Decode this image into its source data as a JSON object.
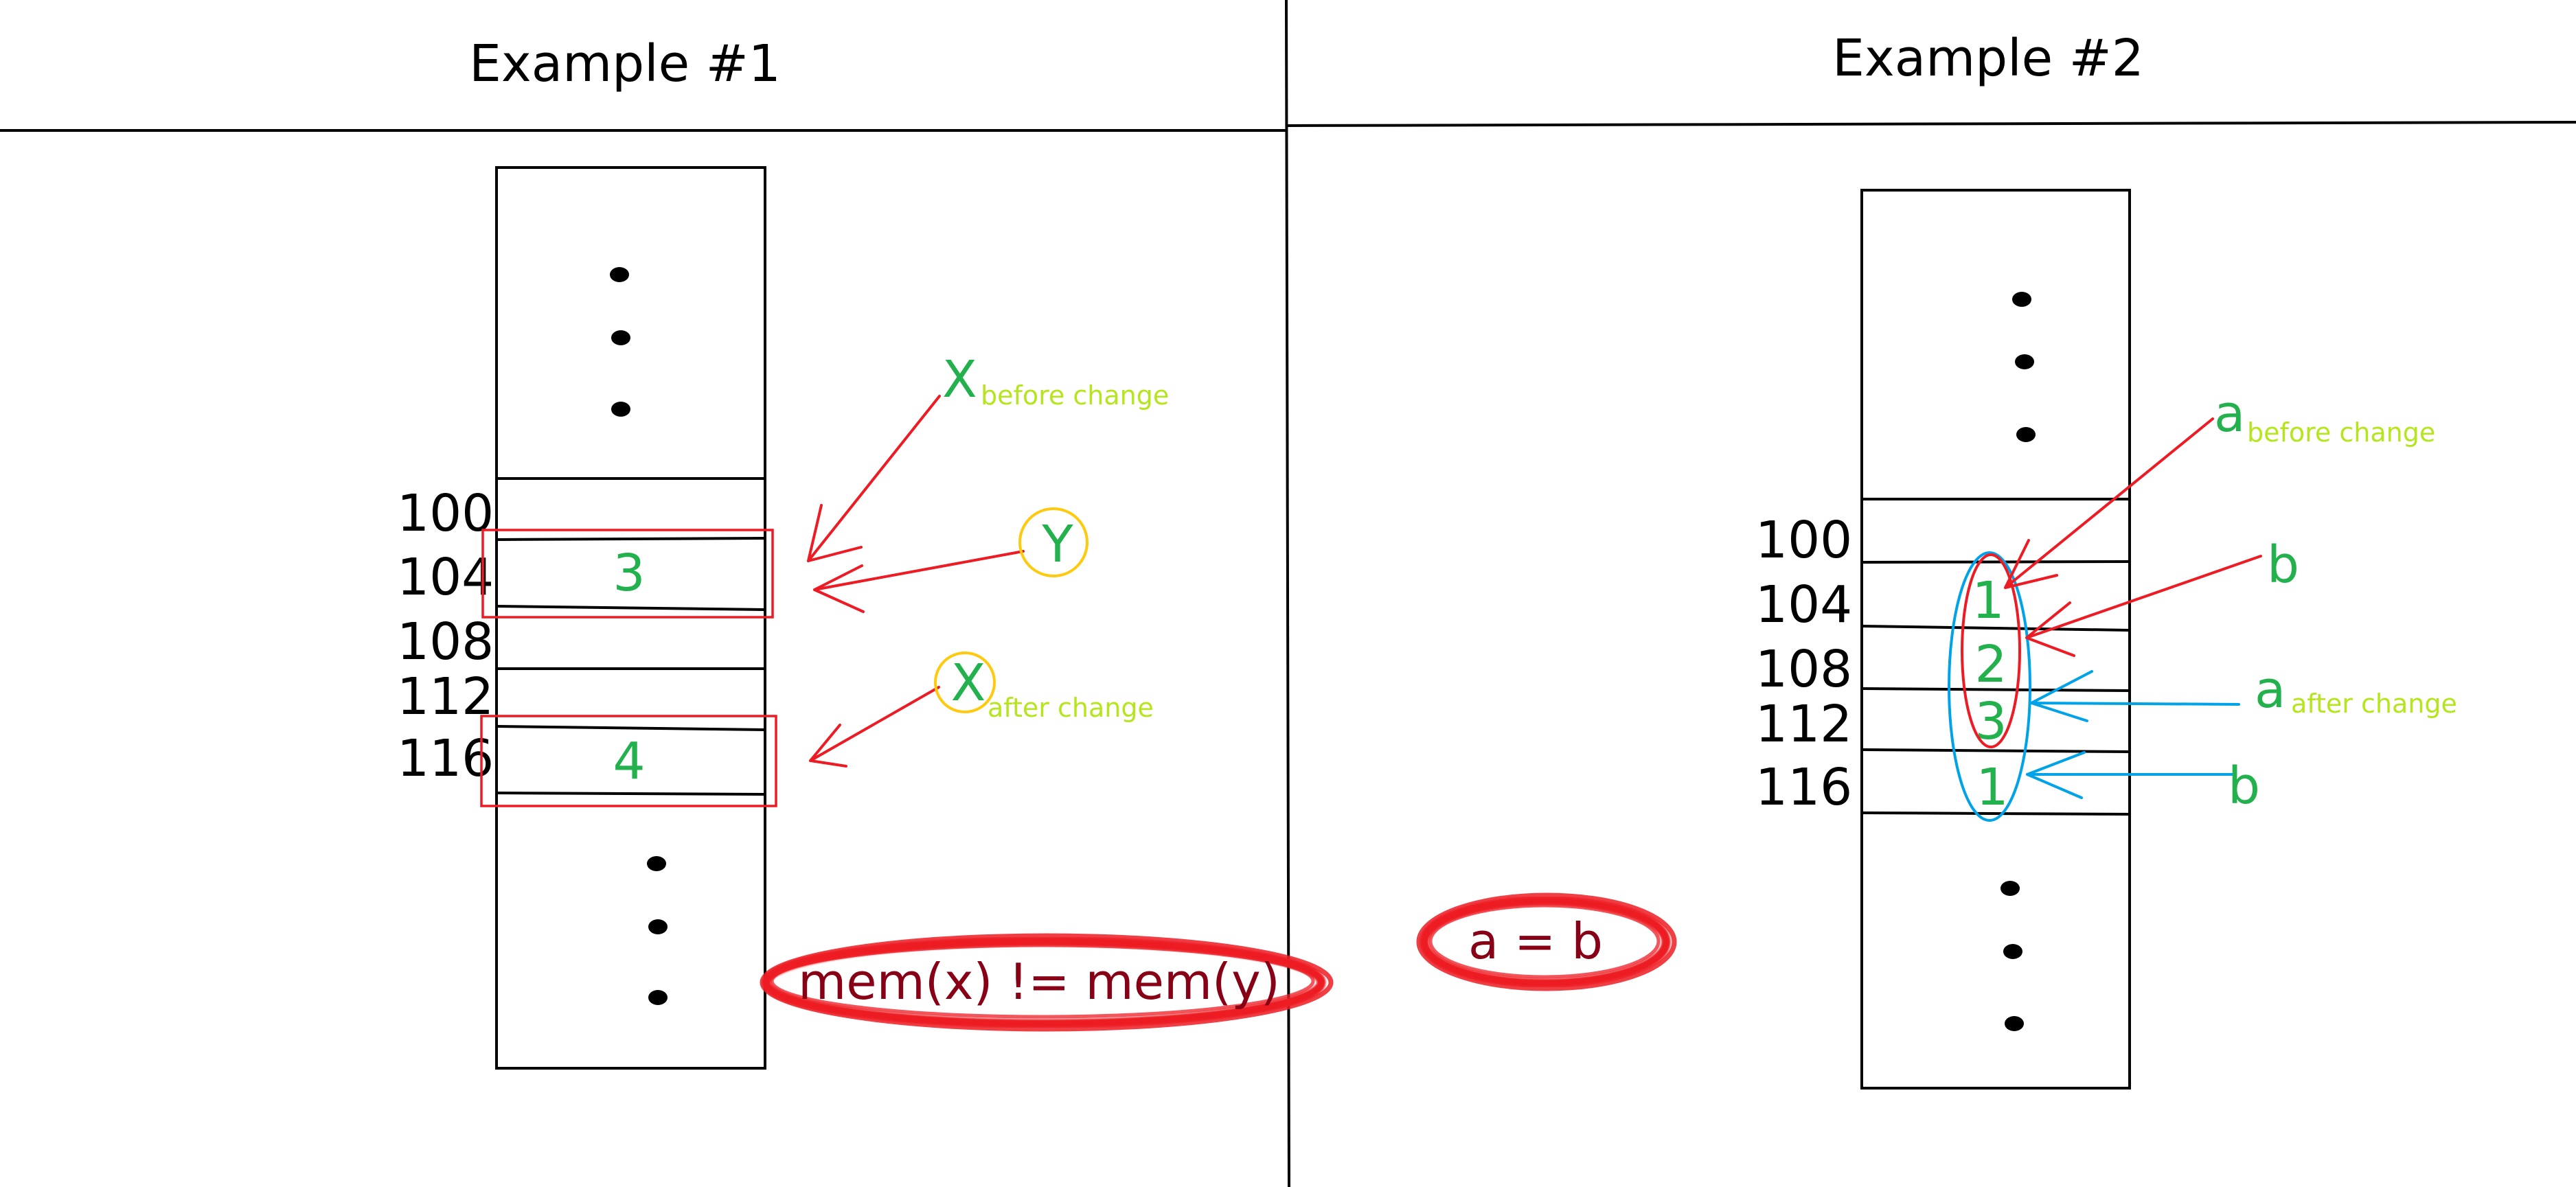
{
  "example1": {
    "title": "Example #1",
    "addresses": [
      "100",
      "104",
      "108",
      "112",
      "116"
    ],
    "values": [
      "3",
      "4"
    ],
    "labels": {
      "x_before": {
        "letter": "X",
        "sub": "before change"
      },
      "y": {
        "letter": "Y"
      },
      "x_after": {
        "letter": "X",
        "sub": "after change"
      }
    },
    "expression": "mem(x) != mem(y)"
  },
  "example2": {
    "title": "Example #2",
    "addresses": [
      "100",
      "104",
      "108",
      "112",
      "116"
    ],
    "values": [
      "1",
      "2",
      "3",
      "1"
    ],
    "labels": {
      "a_before": {
        "letter": "a",
        "sub": "before change"
      },
      "b_first": {
        "letter": "b"
      },
      "a_after": {
        "letter": "a",
        "sub": "after change"
      },
      "b_second": {
        "letter": "b"
      }
    },
    "expression": "a = b"
  },
  "colors": {
    "ink": "#000000",
    "value_green": "#22b14c",
    "subscript_lime": "#b5e61d",
    "arrow_red": "#ed1c24",
    "highlight_blue": "#00a2e8",
    "circle_yellow": "#ffc90e",
    "expression_darkred": "#880015"
  }
}
